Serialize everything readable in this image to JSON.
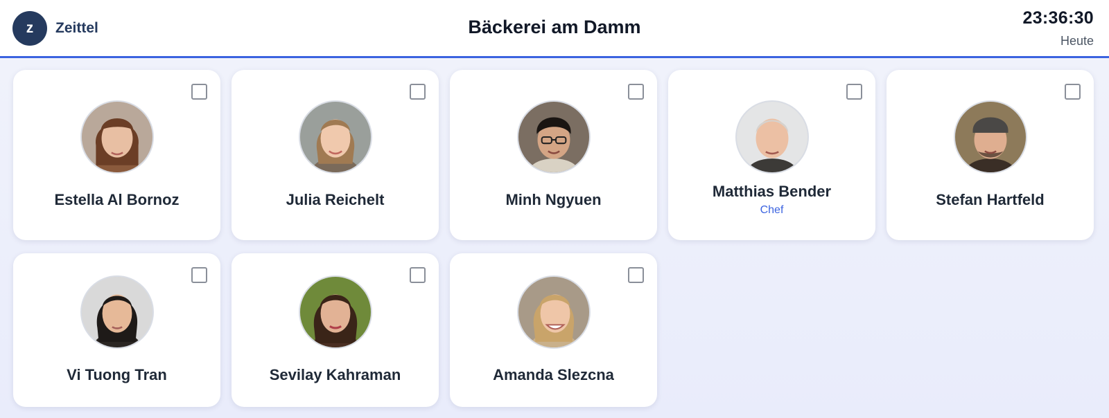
{
  "app": {
    "logo_letter": "z",
    "brand": "Zeittel"
  },
  "store": {
    "title": "Bäckerei am Damm"
  },
  "clock": {
    "time": "23:36:30",
    "day": "Heute"
  },
  "colors": {
    "accent": "#3b63e0",
    "brand_dark": "#253a5e",
    "role": "#3b63e0"
  },
  "employees": [
    {
      "name": "Estella Al Bornoz",
      "role": "",
      "avatar_icon": "person-photo",
      "selected": false
    },
    {
      "name": "Julia Reichelt",
      "role": "",
      "avatar_icon": "person-photo",
      "selected": false
    },
    {
      "name": "Minh Ngyuen",
      "role": "",
      "avatar_icon": "person-photo",
      "selected": false
    },
    {
      "name": "Matthias Bender",
      "role": "Chef",
      "avatar_icon": "person-photo",
      "selected": false
    },
    {
      "name": "Stefan Hartfeld",
      "role": "",
      "avatar_icon": "person-photo",
      "selected": false
    },
    {
      "name": "Vi Tuong Tran",
      "role": "",
      "avatar_icon": "person-photo",
      "selected": false
    },
    {
      "name": "Sevilay Kahraman",
      "role": "",
      "avatar_icon": "person-photo",
      "selected": false
    },
    {
      "name": "Amanda Slezcna",
      "role": "",
      "avatar_icon": "person-photo",
      "selected": false
    }
  ]
}
